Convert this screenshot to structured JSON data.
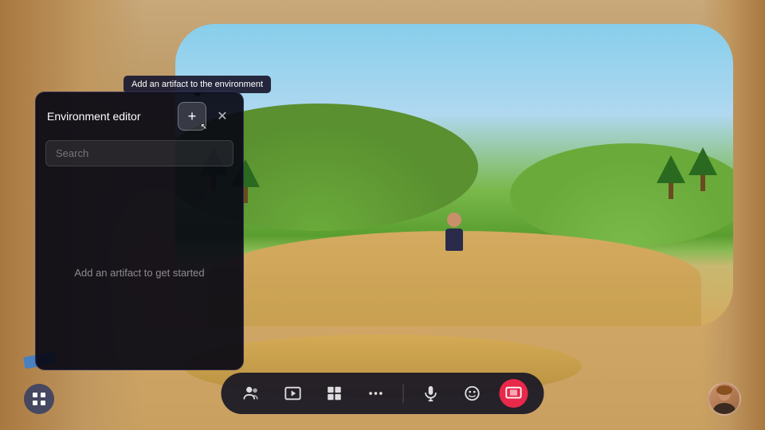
{
  "scene": {
    "background_color": "#c8a87a"
  },
  "tooltip": {
    "text": "Add an artifact to the environment"
  },
  "env_panel": {
    "title": "Environment editor",
    "add_btn_label": "+",
    "close_btn_label": "✕",
    "search_placeholder": "Search",
    "empty_state_text": "Add an artifact to get started"
  },
  "toolbar": {
    "buttons": [
      {
        "name": "people-btn",
        "icon": "👥",
        "label": "People",
        "active": false
      },
      {
        "name": "media-btn",
        "icon": "🎬",
        "label": "Media",
        "active": false
      },
      {
        "name": "content-btn",
        "icon": "📋",
        "label": "Content",
        "active": false
      },
      {
        "name": "more-btn",
        "icon": "•••",
        "label": "More",
        "active": false
      },
      {
        "name": "mic-btn",
        "icon": "🎙",
        "label": "Microphone",
        "active": false
      },
      {
        "name": "emoji-btn",
        "icon": "😊",
        "label": "Emoji",
        "active": false
      },
      {
        "name": "share-btn",
        "icon": "📤",
        "label": "Share",
        "active": true
      }
    ],
    "grid_btn_label": "⊞"
  }
}
